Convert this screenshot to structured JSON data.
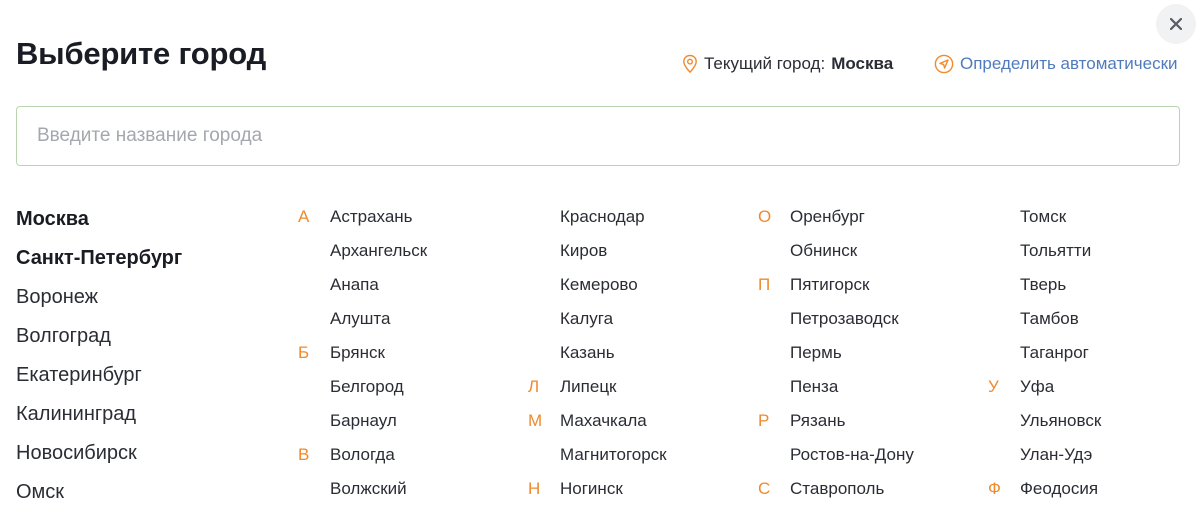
{
  "header": {
    "title": "Выберите город",
    "current_label": "Текущий город:",
    "current_city": "Москва",
    "auto_detect_label": "Определить автоматически"
  },
  "search": {
    "placeholder": "Введите название города",
    "value": ""
  },
  "colors": {
    "accent_letter": "#ef8a2e",
    "link": "#4f7bbd",
    "input_border": "#b9d6b0"
  },
  "popular_cities": [
    {
      "name": "Москва",
      "bold": true
    },
    {
      "name": "Санкт-Петербург",
      "bold": true
    },
    {
      "name": "Воронеж",
      "bold": false
    },
    {
      "name": "Волгоград",
      "bold": false
    },
    {
      "name": "Екатеринбург",
      "bold": false
    },
    {
      "name": "Калининград",
      "bold": false
    },
    {
      "name": "Новосибирск",
      "bold": false
    },
    {
      "name": "Омск",
      "bold": false
    }
  ],
  "columns": [
    [
      {
        "letter": "А",
        "city": "Астрахань"
      },
      {
        "letter": "",
        "city": "Архангельск"
      },
      {
        "letter": "",
        "city": "Анапа"
      },
      {
        "letter": "",
        "city": "Алушта"
      },
      {
        "letter": "Б",
        "city": "Брянск"
      },
      {
        "letter": "",
        "city": "Белгород"
      },
      {
        "letter": "",
        "city": "Барнаул"
      },
      {
        "letter": "В",
        "city": "Вологда"
      },
      {
        "letter": "",
        "city": "Волжский"
      }
    ],
    [
      {
        "letter": "",
        "city": "Краснодар"
      },
      {
        "letter": "",
        "city": "Киров"
      },
      {
        "letter": "",
        "city": "Кемерово"
      },
      {
        "letter": "",
        "city": "Калуга"
      },
      {
        "letter": "",
        "city": "Казань"
      },
      {
        "letter": "Л",
        "city": "Липецк"
      },
      {
        "letter": "М",
        "city": "Махачкала"
      },
      {
        "letter": "",
        "city": "Магнитогорск"
      },
      {
        "letter": "Н",
        "city": "Ногинск"
      }
    ],
    [
      {
        "letter": "О",
        "city": "Оренбург"
      },
      {
        "letter": "",
        "city": "Обнинск"
      },
      {
        "letter": "П",
        "city": "Пятигорск"
      },
      {
        "letter": "",
        "city": "Петрозаводск"
      },
      {
        "letter": "",
        "city": "Пермь"
      },
      {
        "letter": "",
        "city": "Пенза"
      },
      {
        "letter": "Р",
        "city": "Рязань"
      },
      {
        "letter": "",
        "city": "Ростов-на-Дону"
      },
      {
        "letter": "С",
        "city": "Ставрополь"
      }
    ],
    [
      {
        "letter": "",
        "city": "Томск"
      },
      {
        "letter": "",
        "city": "Тольятти"
      },
      {
        "letter": "",
        "city": "Тверь"
      },
      {
        "letter": "",
        "city": "Тамбов"
      },
      {
        "letter": "",
        "city": "Таганрог"
      },
      {
        "letter": "У",
        "city": "Уфа"
      },
      {
        "letter": "",
        "city": "Ульяновск"
      },
      {
        "letter": "",
        "city": "Улан-Удэ"
      },
      {
        "letter": "Ф",
        "city": "Феодосия"
      }
    ]
  ]
}
